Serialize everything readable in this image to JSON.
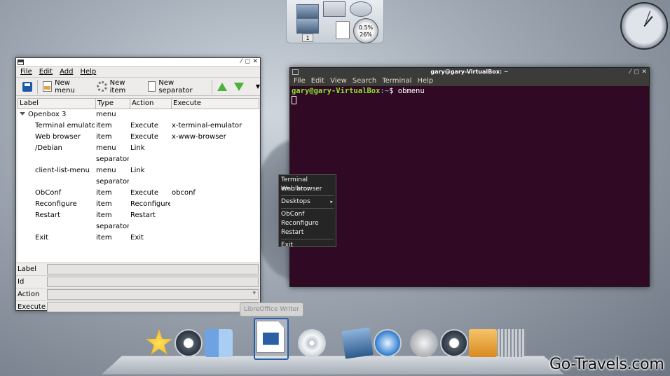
{
  "obmenu": {
    "menubar": [
      "File",
      "Edit",
      "Add",
      "Help"
    ],
    "toolbar": {
      "new_menu": "New menu",
      "new_item": "New item",
      "new_separator": "New separator"
    },
    "columns": [
      "Label",
      "Type",
      "Action",
      "Execute"
    ],
    "rows": [
      {
        "label": "Openbox 3",
        "type": "menu",
        "action": "",
        "execute": "",
        "indent": 0,
        "expander": true
      },
      {
        "label": "Terminal emulator",
        "type": "item",
        "action": "Execute",
        "execute": "x-terminal-emulator",
        "indent": 1
      },
      {
        "label": "Web browser",
        "type": "item",
        "action": "Execute",
        "execute": "x-www-browser",
        "indent": 1
      },
      {
        "label": "/Debian",
        "type": "menu",
        "action": "Link",
        "execute": "",
        "indent": 1
      },
      {
        "label": "",
        "type": "separator",
        "action": "",
        "execute": "",
        "indent": 1
      },
      {
        "label": "client-list-menu",
        "type": "menu",
        "action": "Link",
        "execute": "",
        "indent": 1
      },
      {
        "label": "",
        "type": "separator",
        "action": "",
        "execute": "",
        "indent": 1
      },
      {
        "label": "ObConf",
        "type": "item",
        "action": "Execute",
        "execute": "obconf",
        "indent": 1
      },
      {
        "label": "Reconfigure",
        "type": "item",
        "action": "Reconfigure",
        "execute": "",
        "indent": 1
      },
      {
        "label": "Restart",
        "type": "item",
        "action": "Restart",
        "execute": "",
        "indent": 1
      },
      {
        "label": "",
        "type": "separator",
        "action": "",
        "execute": "",
        "indent": 1
      },
      {
        "label": "Exit",
        "type": "item",
        "action": "Exit",
        "execute": "",
        "indent": 1
      }
    ],
    "properties": {
      "label": "Label",
      "id": "Id",
      "action": "Action",
      "execute": "Execute"
    }
  },
  "terminal": {
    "title": "gary@gary-VirtualBox: ~",
    "menubar": [
      "File",
      "Edit",
      "View",
      "Search",
      "Terminal",
      "Help"
    ],
    "prompt_user": "gary@gary-VirtualBox",
    "prompt_path": ":~",
    "prompt_symbol": "$",
    "command": "obmenu"
  },
  "root_menu": [
    {
      "type": "item",
      "label": "Terminal emulator"
    },
    {
      "type": "item",
      "label": "Web browser"
    },
    {
      "type": "separator"
    },
    {
      "type": "submenu",
      "label": "Desktops"
    },
    {
      "type": "separator"
    },
    {
      "type": "item",
      "label": "ObConf"
    },
    {
      "type": "item",
      "label": "Reconfigure"
    },
    {
      "type": "item",
      "label": "Restart"
    },
    {
      "type": "separator"
    },
    {
      "type": "item",
      "label": "Exit"
    }
  ],
  "pager": {
    "desktop_count": "1",
    "cpu_percent_1": "0.5%",
    "cpu_percent_2": "26%"
  },
  "tooltip": "LibreOffice Writer",
  "dock": [
    "star-icon",
    "time-machine-icon",
    "finder-icon",
    "libreoffice-writer-icon",
    "dvd-icon",
    "mail-icon",
    "safari-icon",
    "at-sign-icon",
    "time-machine-icon",
    "folder-icon",
    "trash-icon"
  ],
  "watermark": "Go-Travels.com",
  "colors": {
    "terminal_bg": "#300a24",
    "prompt_green": "#8ae234",
    "prompt_blue": "#729fcf"
  }
}
